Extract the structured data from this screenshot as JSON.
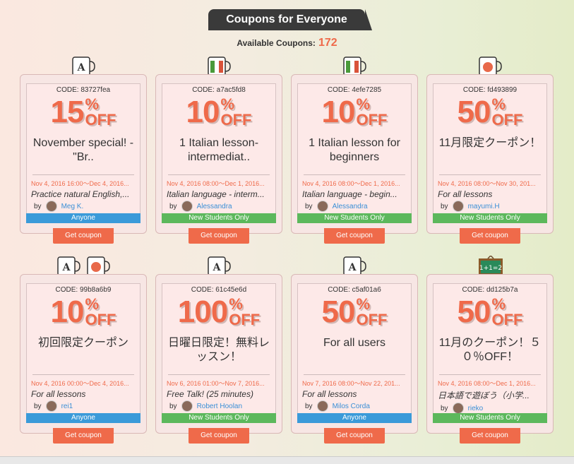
{
  "header": {
    "title": "Coupons for Everyone",
    "available_label": "Available Coupons:",
    "available_count": "172"
  },
  "colors": {
    "accent": "#ef6a4a",
    "blue": "#3a9ad9",
    "green": "#5cb85c",
    "link": "#3a8fd6"
  },
  "coupons": [
    {
      "code": "CODE: 83727fea",
      "num": "15",
      "pct": "%",
      "off": "OFF",
      "title": "November special! - \"Br..",
      "date": "Nov 4, 2016 16:00～Dec 4, 2016...",
      "lesson": "Practice natural English,...",
      "by": "by",
      "teacher": "Meg K.",
      "audience": "Anyone",
      "audience_color": "blue",
      "button": "Get coupon",
      "icons": [
        "english-mug-icon"
      ]
    },
    {
      "code": "CODE: a7ac5fd8",
      "num": "10",
      "pct": "%",
      "off": "OFF",
      "title": "1 Italian lesson- intermediat..",
      "date": "Nov 4, 2016 08:00～Dec 1, 2016...",
      "lesson": "Italian language - interm...",
      "by": "by",
      "teacher": "Alessandra",
      "audience": "New Students Only",
      "audience_color": "green",
      "button": "Get coupon",
      "icons": [
        "italian-mug-icon"
      ]
    },
    {
      "code": "CODE: 4efe7285",
      "num": "10",
      "pct": "%",
      "off": "OFF",
      "title": "1 Italian lesson for beginners",
      "date": "Nov 4, 2016 08:00～Dec 1, 2016...",
      "lesson": "Italian language - begin...",
      "by": "by",
      "teacher": "Alessandra",
      "audience": "New Students Only",
      "audience_color": "green",
      "button": "Get coupon",
      "icons": [
        "italian-mug-icon"
      ]
    },
    {
      "code": "CODE: fd493899",
      "num": "50",
      "pct": "%",
      "off": "OFF",
      "title": "11月限定クーポン！",
      "date": "Nov 4, 2016 08:00～Nov 30, 201...",
      "lesson": "For all lessons",
      "by": "by",
      "teacher": "mayumi.H",
      "audience": "New Students Only",
      "audience_color": "green",
      "button": "Get coupon",
      "icons": [
        "japanese-mug-icon"
      ]
    },
    {
      "code": "CODE: 99b8a6b9",
      "num": "10",
      "pct": "%",
      "off": "OFF",
      "title": "初回限定クーポン",
      "date": "Nov 4, 2016 00:00～Dec 4, 2016...",
      "lesson": "For all lessons",
      "by": "by",
      "teacher": "rei1",
      "audience": "Anyone",
      "audience_color": "blue",
      "button": "Get coupon",
      "icons": [
        "english-mug-icon",
        "japanese-mug-icon"
      ]
    },
    {
      "code": "CODE: 61c45e6d",
      "num": "100",
      "pct": "%",
      "off": "OFF",
      "title": "日曜日限定！無料レッスン！",
      "date": "Nov 6, 2016 01:00～Nov 7, 2016...",
      "lesson": "Free Talk! (25 minutes)",
      "by": "by",
      "teacher": "Robert Hoolan",
      "audience": "New Students Only",
      "audience_color": "green",
      "button": "Get coupon",
      "icons": [
        "english-mug-icon"
      ]
    },
    {
      "code": "CODE: c5af01a6",
      "num": "50",
      "pct": "%",
      "off": "OFF",
      "title": "For all users",
      "date": "Nov 7, 2016 08:00～Nov 22, 201...",
      "lesson": "For all lessons",
      "by": "by",
      "teacher": "Milos Corda",
      "audience": "Anyone",
      "audience_color": "blue",
      "button": "Get coupon",
      "icons": [
        "english-mug-icon"
      ]
    },
    {
      "code": "CODE: dd125b7a",
      "num": "50",
      "pct": "%",
      "off": "OFF",
      "title": "11月のクーポン！５０％OFF！",
      "date": "Nov 4, 2016 08:00～Dec 1, 2016...",
      "lesson": "日本語で遊ぼう（小学...",
      "by": "by",
      "teacher": "rieko",
      "audience": "New Students Only",
      "audience_color": "green",
      "button": "Get coupon",
      "icons": [
        "chalkboard-icon"
      ]
    }
  ],
  "chalkboard_text": "1+1=2"
}
